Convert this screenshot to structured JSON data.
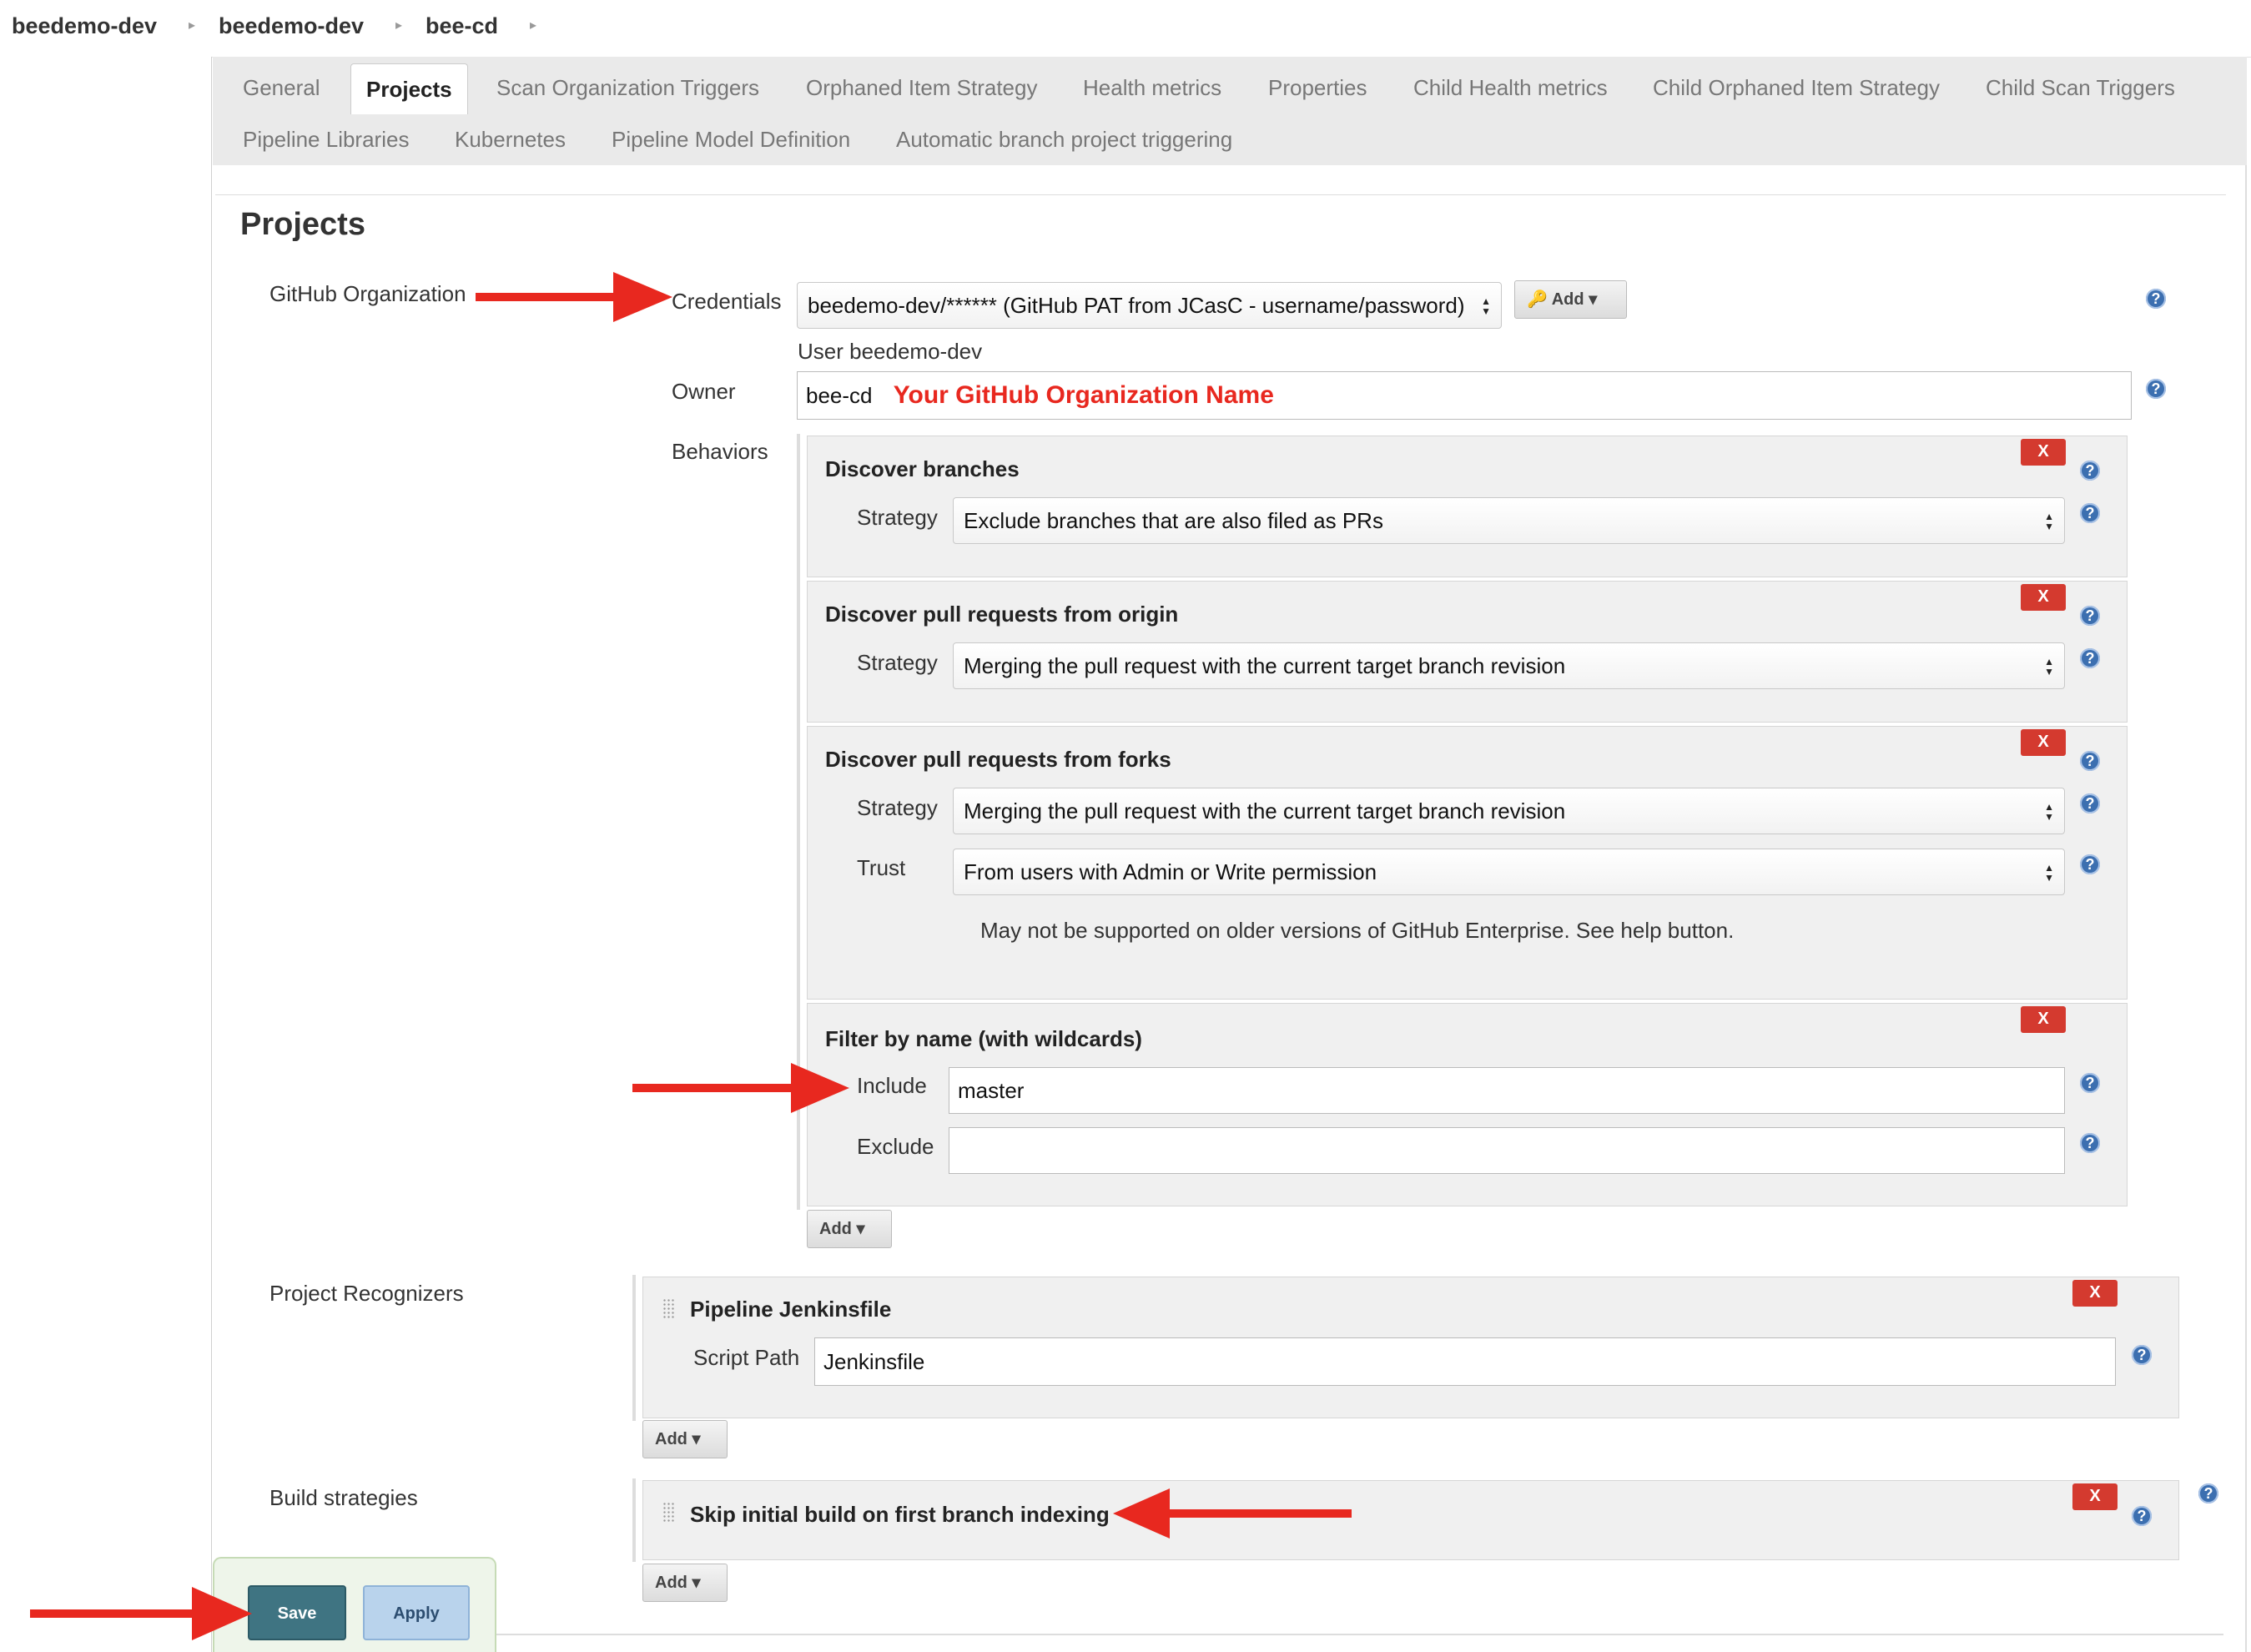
{
  "breadcrumb": {
    "items": [
      "beedemo-dev",
      "beedemo-dev",
      "bee-cd"
    ]
  },
  "tabs": [
    "General",
    "Projects",
    "Scan Organization Triggers",
    "Orphaned Item Strategy",
    "Health metrics",
    "Properties",
    "Child Health metrics",
    "Child Orphaned Item Strategy",
    "Child Scan Triggers",
    "Pipeline Libraries",
    "Kubernetes",
    "Pipeline Model Definition",
    "Automatic branch project triggering"
  ],
  "active_tab": "Projects",
  "section_title": "Projects",
  "github_org": {
    "label": "GitHub Organization",
    "credentials_label": "Credentials",
    "credentials_value": "beedemo-dev/****** (GitHub PAT from JCasC - username/password)",
    "add_label": "Add",
    "user_line": "User beedemo-dev",
    "owner_label": "Owner",
    "owner_value": "bee-cd",
    "owner_annotation": "Your GitHub Organization Name",
    "behaviors_label": "Behaviors"
  },
  "behaviors": {
    "discover_branches": {
      "title": "Discover branches",
      "strategy_label": "Strategy",
      "strategy_value": "Exclude branches that are also filed as PRs"
    },
    "discover_pr_origin": {
      "title": "Discover pull requests from origin",
      "strategy_label": "Strategy",
      "strategy_value": "Merging the pull request with the current target branch revision"
    },
    "discover_pr_forks": {
      "title": "Discover pull requests from forks",
      "strategy_label": "Strategy",
      "strategy_value": "Merging the pull request with the current target branch revision",
      "trust_label": "Trust",
      "trust_value": "From users with Admin or Write permission",
      "note": "May not be supported on older versions of GitHub Enterprise. See help button."
    },
    "filter_by_name": {
      "title": "Filter by name (with wildcards)",
      "include_label": "Include",
      "include_value": "master",
      "exclude_label": "Exclude",
      "exclude_value": ""
    },
    "add_label": "Add"
  },
  "project_recognizers": {
    "label": "Project Recognizers",
    "title": "Pipeline Jenkinsfile",
    "script_path_label": "Script Path",
    "script_path_value": "Jenkinsfile",
    "add_label": "Add"
  },
  "build_strategies": {
    "label": "Build strategies",
    "title": "Skip initial build on first branch indexing",
    "add_label": "Add"
  },
  "remove_label": "X",
  "buttons": {
    "save": "Save",
    "apply": "Apply"
  },
  "colors": {
    "accent_red": "#e8281f",
    "remove_red": "#d43a2f",
    "save_teal": "#3f7482",
    "apply_blue": "#b9d3ec",
    "help_blue": "#3c6fb0"
  }
}
